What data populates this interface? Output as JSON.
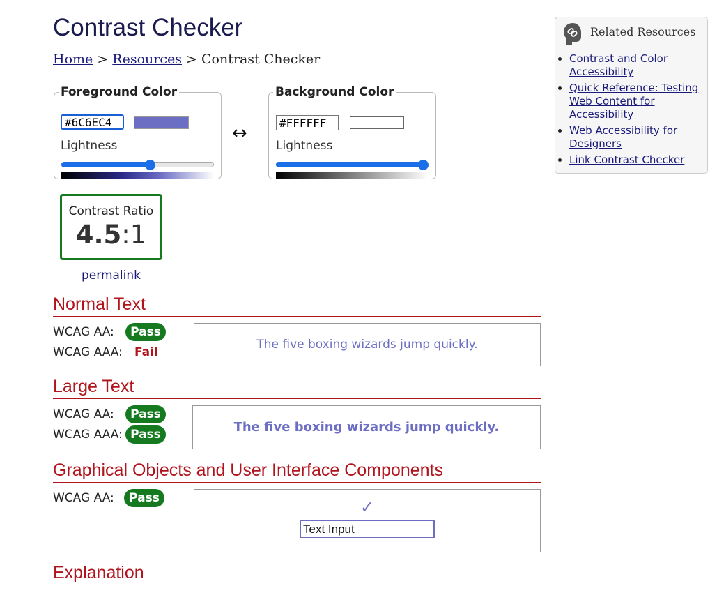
{
  "page": {
    "title": "Contrast Checker"
  },
  "breadcrumb": {
    "home": "Home",
    "sep1": ">",
    "resources": "Resources",
    "sep2": ">",
    "current": "Contrast Checker"
  },
  "foreground": {
    "legend": "Foreground Color",
    "hex": "#6C6EC4",
    "swatch_color": "#6C6EC4",
    "lightness_label": "Lightness",
    "lightness_fraction": 0.59
  },
  "background": {
    "legend": "Background Color",
    "hex": "#FFFFFF",
    "swatch_color": "#FFFFFF",
    "lightness_label": "Lightness",
    "lightness_fraction": 1.0
  },
  "swap_glyph": "↔",
  "contrast": {
    "label": "Contrast Ratio",
    "value": "4.5",
    "suffix": ":1",
    "permalink": "permalink"
  },
  "normal_text": {
    "heading": "Normal Text",
    "aa_label": "WCAG AA:",
    "aa_result": "Pass",
    "aaa_label": "WCAG AAA:",
    "aaa_result": "Fail",
    "sample": "The five boxing wizards jump quickly."
  },
  "large_text": {
    "heading": "Large Text",
    "aa_label": "WCAG AA:",
    "aa_result": "Pass",
    "aaa_label": "WCAG AAA:",
    "aaa_result": "Pass",
    "sample": "The five boxing wizards jump quickly."
  },
  "graphical": {
    "heading": "Graphical Objects and User Interface Components",
    "aa_label": "WCAG AA:",
    "aa_result": "Pass",
    "check_glyph": "✓",
    "input_value": "Text Input"
  },
  "explanation": {
    "heading": "Explanation"
  },
  "related": {
    "heading": "Related Resources",
    "icon": "link-icon",
    "links": [
      "Contrast and Color Accessibility",
      "Quick Reference: Testing Web Content for Accessibility",
      "Web Accessibility for Designers",
      "Link Contrast Checker"
    ]
  },
  "colors": {
    "pass": "#157A1F",
    "fail": "#B0151E",
    "heading": "#B0151E",
    "accent": "#1A6FE8"
  }
}
